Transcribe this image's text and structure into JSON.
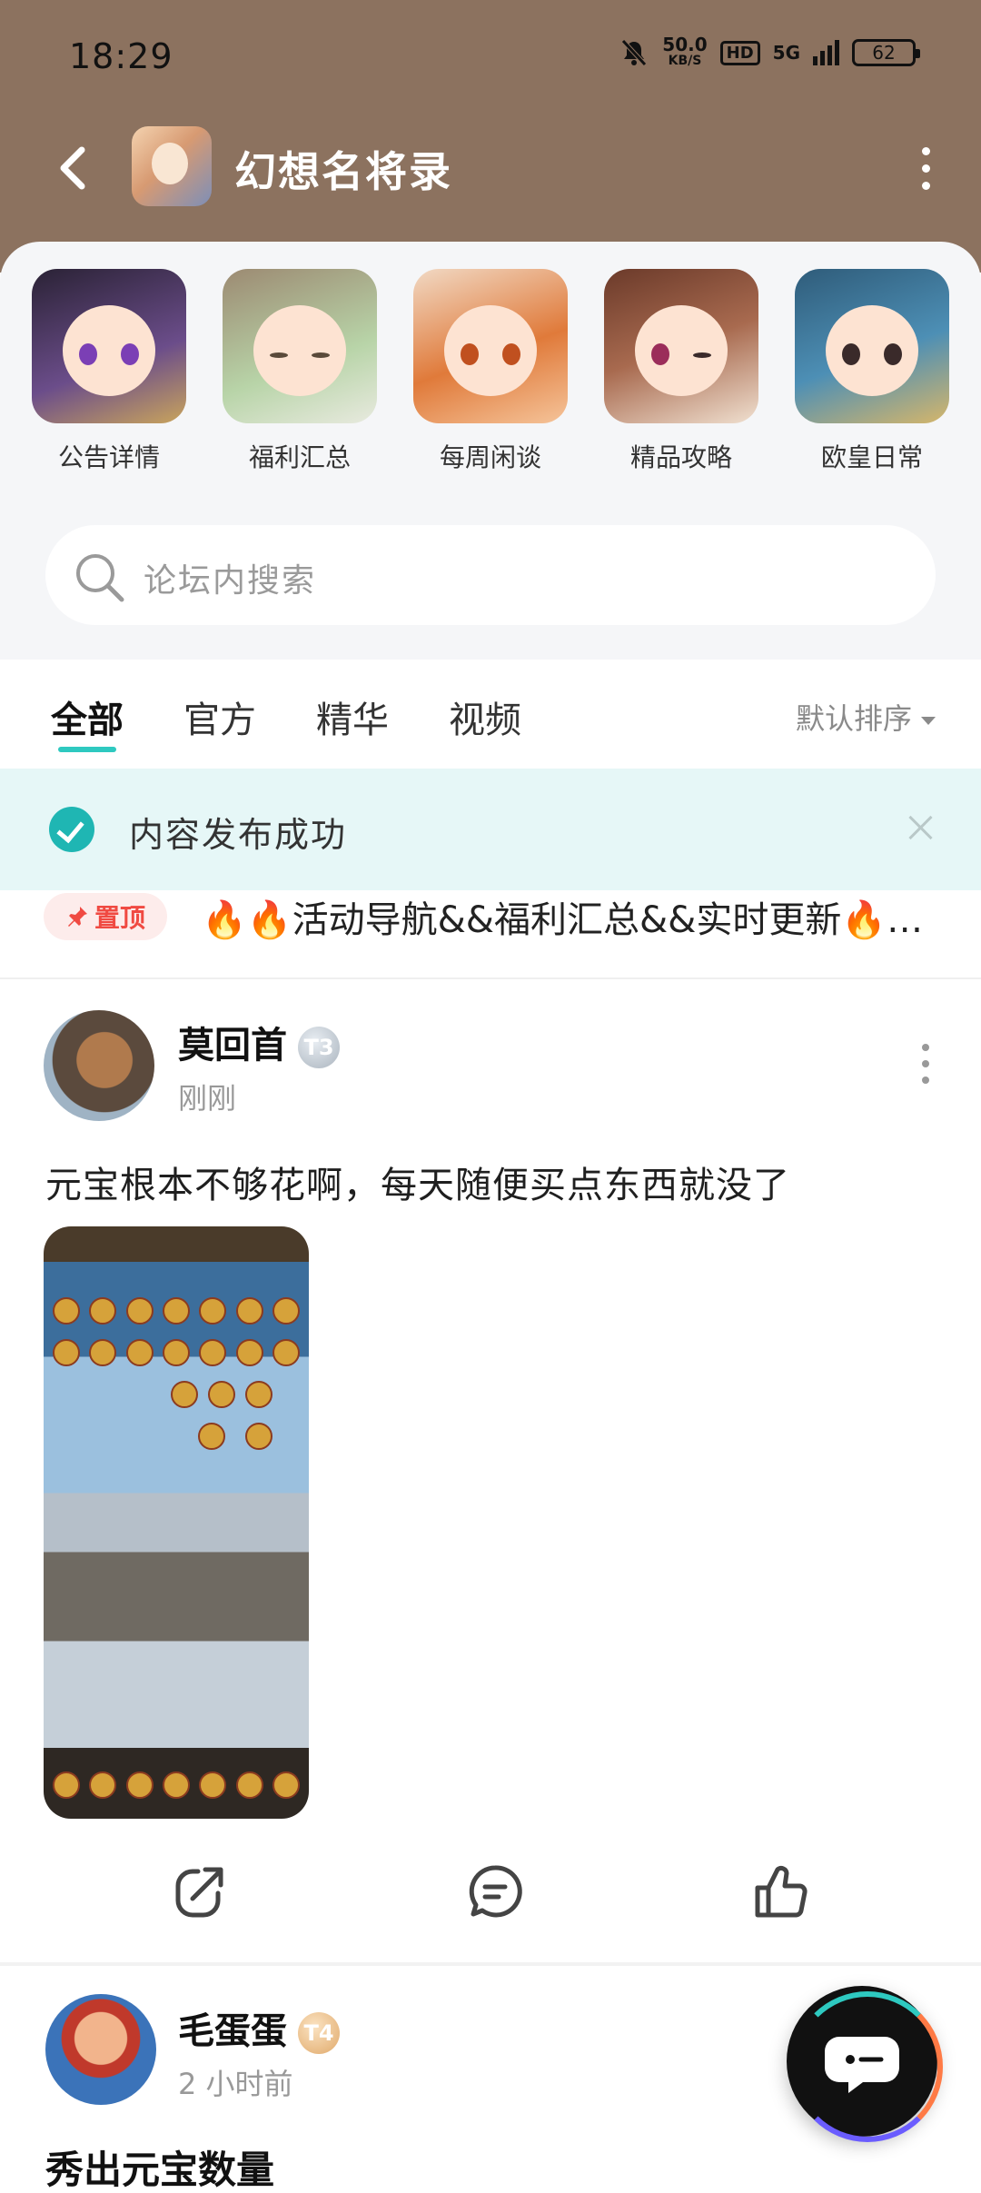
{
  "status_bar": {
    "time": "18:29",
    "net_speed": "50.0",
    "net_unit": "KB/S",
    "hd": "HD",
    "network": "5G",
    "battery": "62"
  },
  "header": {
    "title": "幻想名将录"
  },
  "categories": [
    {
      "label": "公告详情",
      "icon": "avatar-icon"
    },
    {
      "label": "福利汇总",
      "icon": "avatar-icon"
    },
    {
      "label": "每周闲谈",
      "icon": "avatar-icon"
    },
    {
      "label": "精品攻略",
      "icon": "avatar-icon"
    },
    {
      "label": "欧皇日常",
      "icon": "avatar-icon"
    }
  ],
  "search": {
    "placeholder": "论坛内搜索"
  },
  "tabs": [
    {
      "label": "全部",
      "active": true
    },
    {
      "label": "官方",
      "active": false
    },
    {
      "label": "精华",
      "active": false
    },
    {
      "label": "视频",
      "active": false
    }
  ],
  "sort": {
    "label": "默认排序"
  },
  "toast": {
    "message": "内容发布成功"
  },
  "pinned": {
    "badge": "置顶",
    "text": "🔥🔥活动导航&&福利汇总&&实时更新🔥…"
  },
  "posts": [
    {
      "user": "莫回首",
      "level": "T3",
      "time": "刚刚",
      "content": "元宝根本不够花啊，每天随便买点东西就没了"
    },
    {
      "user": "毛蛋蛋",
      "level": "T4",
      "time": "2 小时前",
      "title": "秀出元宝数量"
    }
  ],
  "colors": {
    "header_bg": "#8c725f",
    "accent": "#2ec9c0",
    "toast_bg": "#e6f7f7",
    "pin_red": "#f04a42"
  }
}
